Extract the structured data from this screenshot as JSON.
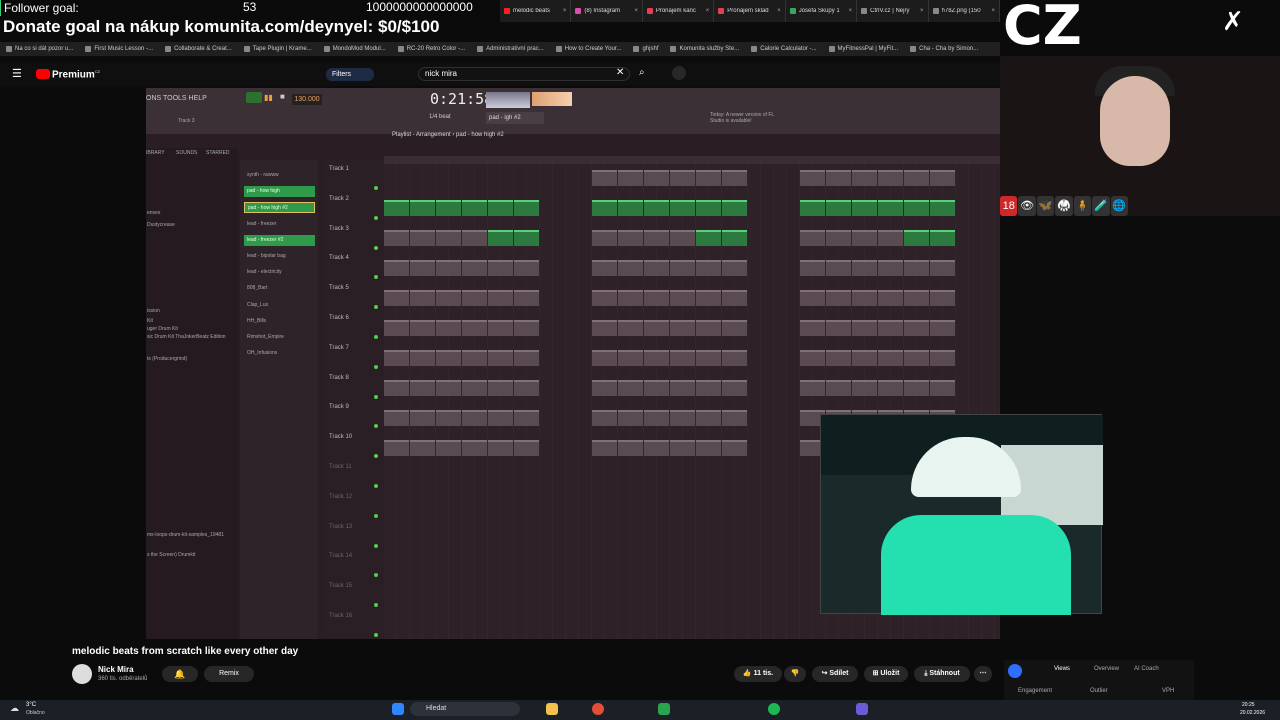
{
  "overlay": {
    "goal_label": "Follower goal:",
    "goal_count": "53",
    "goal_number": "1000000000000000",
    "goal_progress": 0.0,
    "donate_text": "Donate goal na nákup komunita.com/deynyel: $0/$100",
    "cz_text": "CZ"
  },
  "browser": {
    "tabs": [
      {
        "label": "melodic beats",
        "color": "#ff2020"
      },
      {
        "label": "(8) Instagram",
        "color": "#d94ea8"
      },
      {
        "label": "Pronájem kanc",
        "color": "#e04050"
      },
      {
        "label": "Pronájem sklad",
        "color": "#e04050"
      },
      {
        "label": "Josefa Skupy 1",
        "color": "#3ba55d"
      },
      {
        "label": "CtrlV.cz | Nejry",
        "color": "#888"
      },
      {
        "label": "h78Z.png (150",
        "color": "#888"
      }
    ],
    "bookmarks": [
      "Na co si dát pozor u...",
      "First Music Lesson -...",
      "Collaborate & Creat...",
      "Tape Plugin | Krame...",
      "MondoMod Modul...",
      "RC-20 Retro Color -...",
      "Administrativní prac...",
      "How to Create Your...",
      "ghjshf",
      "Komunita služby Ste...",
      "Calorie Calculator -...",
      "MyFitnessPal | MyFit...",
      "Cha - Cha by Simon..."
    ]
  },
  "youtube": {
    "premium_label": "Premium",
    "premium_sup": "CZ",
    "filters_label": "Filters",
    "search_value": "nick mira",
    "video_title": "melodic beats from scratch like every other day",
    "channel_name": "Nick Mira",
    "subscribers": "360 tis. odběratelů",
    "remix_label": "Remix",
    "likes": "11 tis.",
    "share_label": "Sdílet",
    "save_label": "Uložit",
    "download_label": "Stáhnout",
    "panel_tabs": [
      "Views",
      "Overview",
      "AI Coach"
    ],
    "panel_labels": [
      "Engagement",
      "Outlier",
      "VPH"
    ]
  },
  "fl": {
    "menu_text": "ONS TOOLS HELP",
    "bpm": "130.000",
    "time": "0:21:58",
    "snap": "1/4 beat",
    "pattern_selector": "pad - igh #2",
    "playlist_title": "Playlist - Arrangement › pad - how high #2",
    "news": "Today: A newer version of FL Studio is available!",
    "browser_tabs": [
      "IBRARY",
      "SOUNDS",
      "STARRED"
    ],
    "browser_items": [
      "enses",
      "Dustycrease",
      "ission",
      "Kit",
      "uger Drum Kit",
      "sic Drum Kit ThaJnkerBeatz Edition",
      "ts (Producergrind)",
      "ms-loops-drum-kit-samples_19481",
      "s the Screen) Drumkit"
    ],
    "patterns": [
      {
        "label": "synth - rawww",
        "green": false
      },
      {
        "label": "pad - how high",
        "green": true
      },
      {
        "label": "pad - how high #2",
        "green": true,
        "selected": true
      },
      {
        "label": "lead - freezer",
        "green": false
      },
      {
        "label": "lead - freezer #2",
        "green": true
      },
      {
        "label": "lead - bipolar bag",
        "green": false
      },
      {
        "label": "lead - electricity",
        "green": false
      },
      {
        "label": "808_Bart",
        "green": false
      },
      {
        "label": "Clap_Lux",
        "green": false
      },
      {
        "label": "HH_Bills",
        "green": false
      },
      {
        "label": "Rimshot_Empire",
        "green": false
      },
      {
        "label": "OH_Infusions",
        "green": false
      }
    ],
    "tracks": [
      "Track 1",
      "Track 2",
      "Track 3",
      "Track 4",
      "Track 5",
      "Track 6",
      "Track 7",
      "Track 8",
      "Track 9",
      "Track 10",
      "Track 11",
      "Track 12",
      "Track 13",
      "Track 14",
      "Track 15",
      "Track 16"
    ],
    "track_label": "Track 3"
  },
  "taskbar": {
    "weather_temp": "3°C",
    "weather_desc": "Oblačno",
    "search_label": "Hledat",
    "clock_time": "20:25",
    "clock_date": "20.02.2026"
  },
  "icons18": [
    "18",
    "👁",
    "🦋",
    "🥋",
    "🧍",
    "🧪",
    "🌐"
  ]
}
